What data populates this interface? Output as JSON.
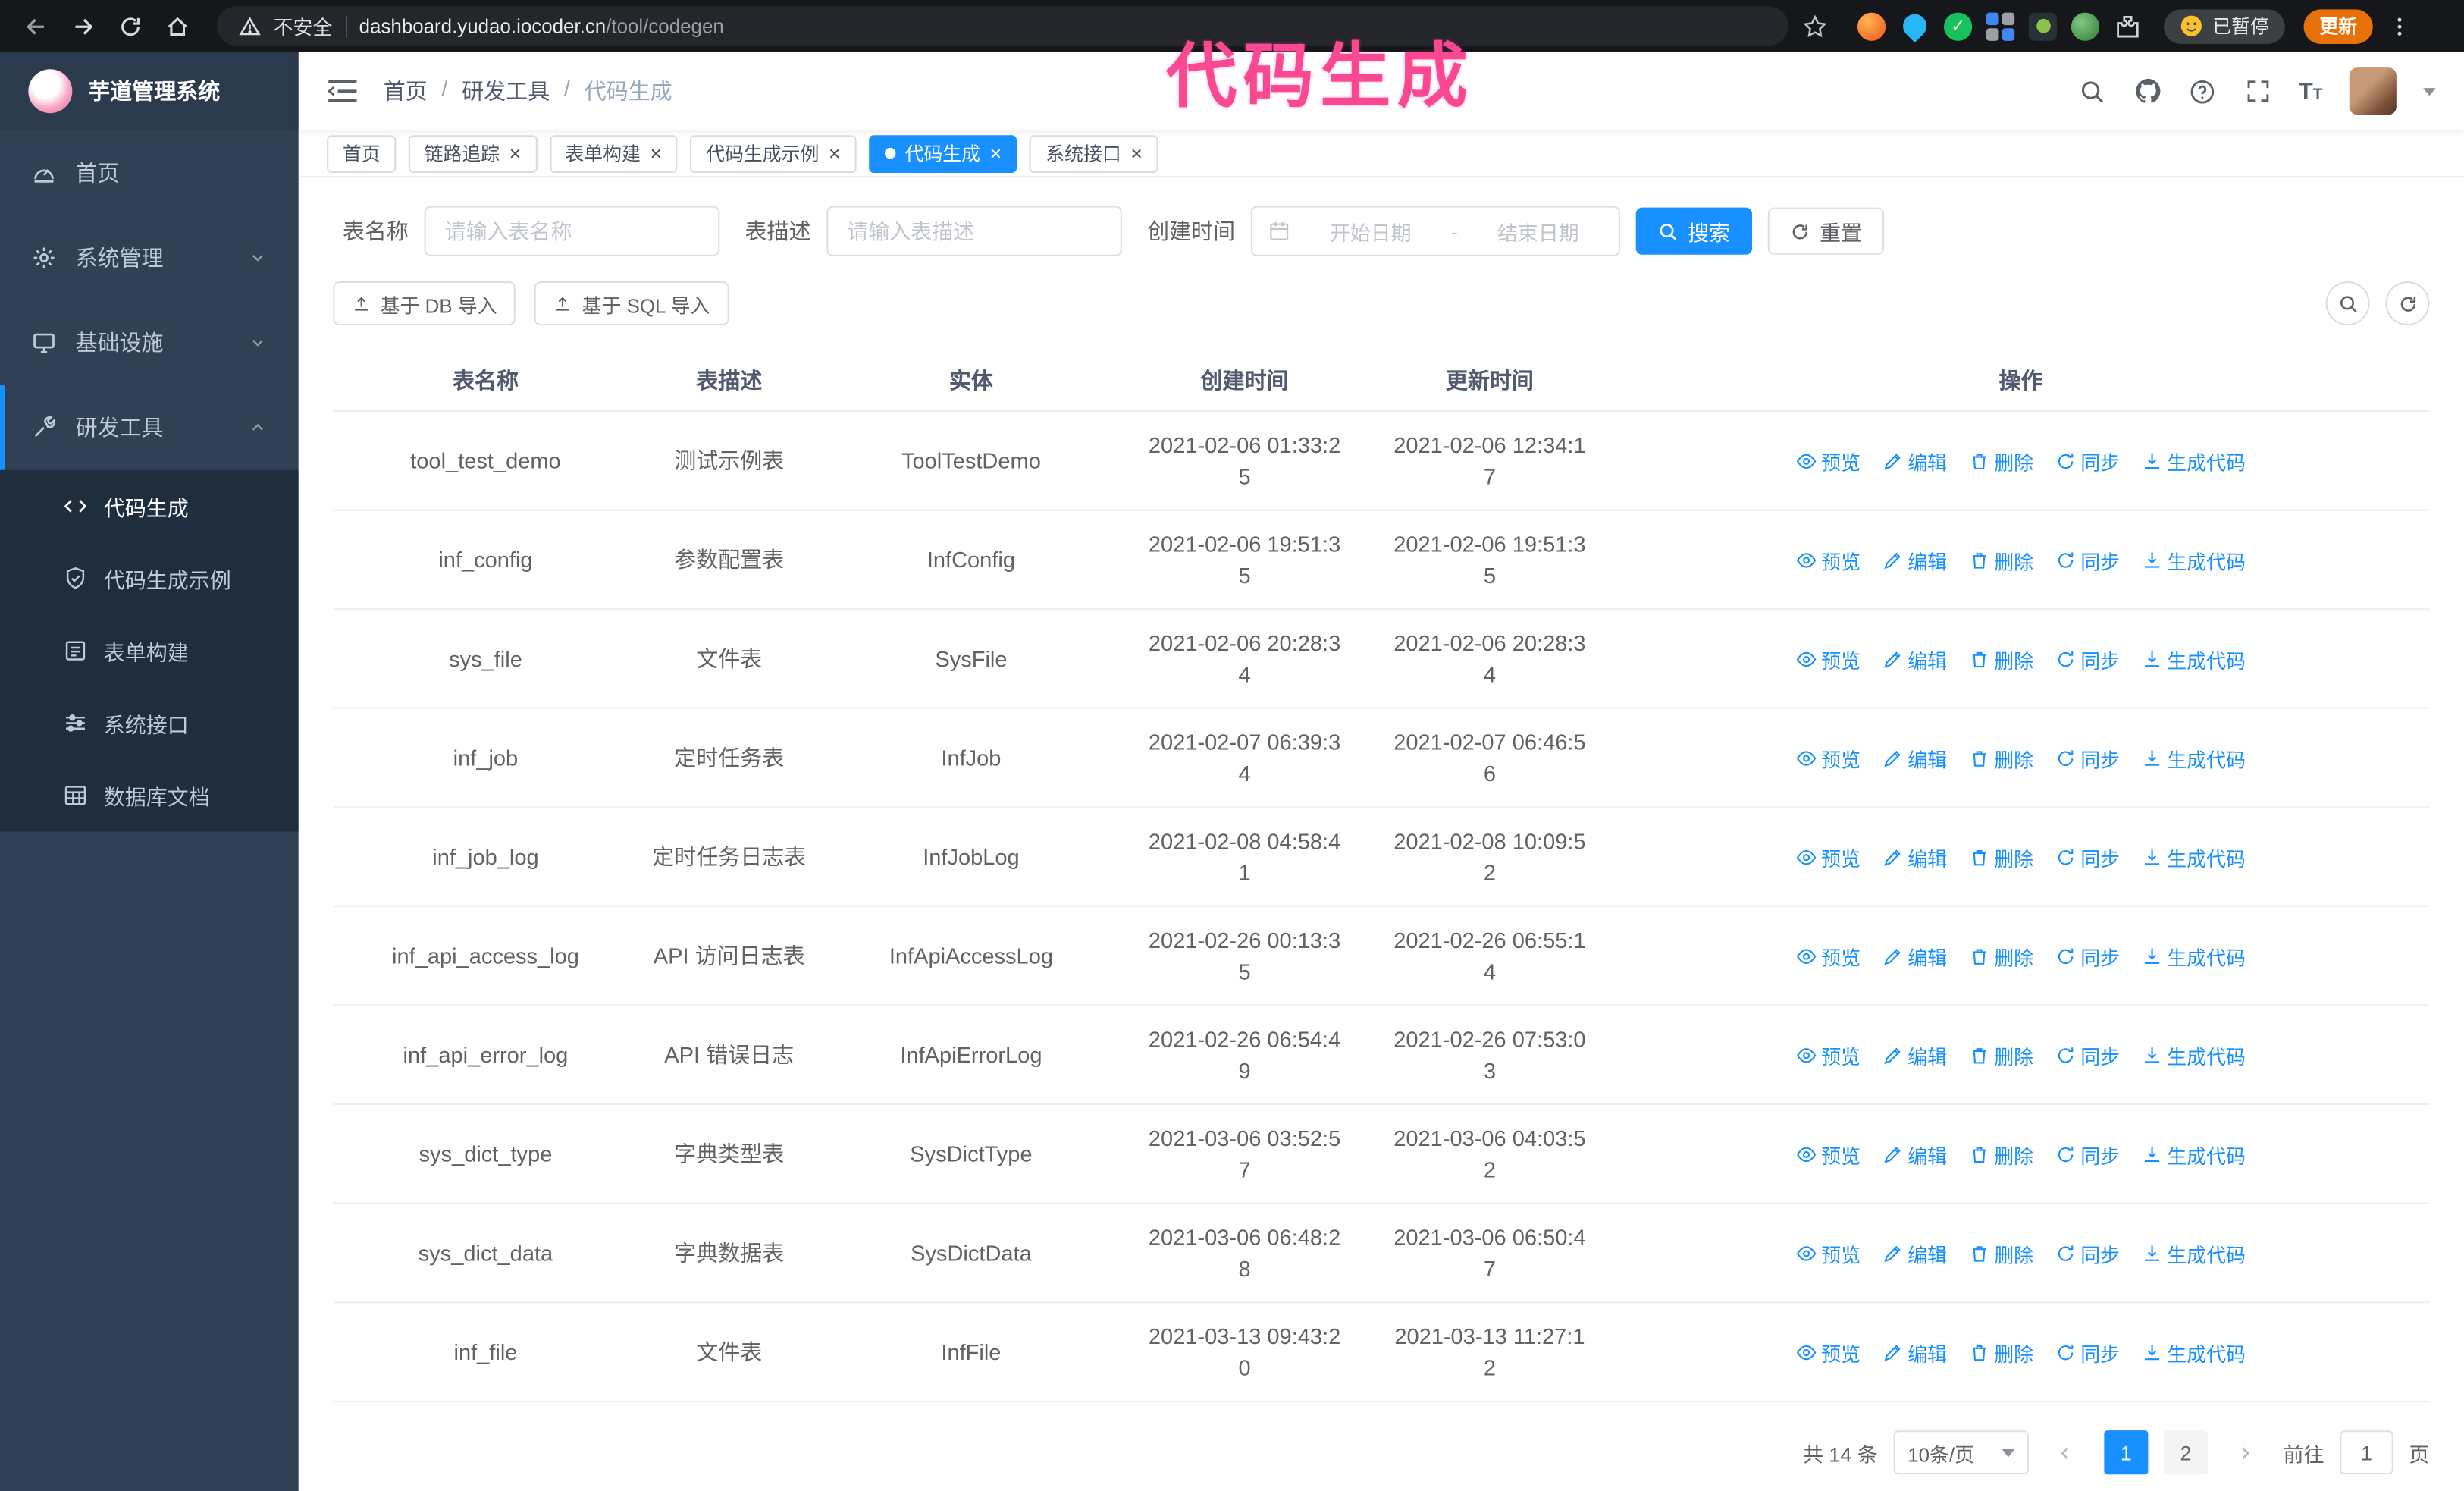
{
  "browser": {
    "security_label": "不安全",
    "url_host": "dashboard.yudao.iocoder.cn",
    "url_path": "/tool/codegen",
    "paused_badge": "已暂停",
    "update_button": "更新"
  },
  "overlay": {
    "title": "代码生成",
    "color": "#fb4893"
  },
  "sidebar": {
    "logo_title": "芋道管理系统",
    "items": [
      {
        "label": "首页"
      },
      {
        "label": "系统管理"
      },
      {
        "label": "基础设施"
      },
      {
        "label": "研发工具"
      }
    ],
    "sub_items": [
      {
        "label": "代码生成",
        "active": true
      },
      {
        "label": "代码生成示例"
      },
      {
        "label": "表单构建"
      },
      {
        "label": "系统接口"
      },
      {
        "label": "数据库文档"
      }
    ]
  },
  "header": {
    "breadcrumb": [
      "首页",
      "研发工具",
      "代码生成"
    ],
    "breadcrumb_separator": "/"
  },
  "tabs": {
    "items": [
      "首页",
      "链路追踪",
      "表单构建",
      "代码生成示例",
      "代码生成",
      "系统接口"
    ],
    "active_tab": "代码生成"
  },
  "filters": {
    "table_name_label": "表名称",
    "table_name_placeholder": "请输入表名称",
    "table_desc_label": "表描述",
    "table_desc_placeholder": "请输入表描述",
    "create_time_label": "创建时间",
    "date_start_placeholder": "开始日期",
    "date_separator": "-",
    "date_end_placeholder": "结束日期",
    "search_button": "搜索",
    "reset_button": "重置"
  },
  "toolbar": {
    "import_db_button": "基于 DB 导入",
    "import_sql_button": "基于 SQL 导入"
  },
  "table": {
    "columns": [
      "表名称",
      "表描述",
      "实体",
      "创建时间",
      "更新时间",
      "操作"
    ],
    "action_labels": [
      "预览",
      "编辑",
      "删除",
      "同步",
      "生成代码"
    ],
    "rows": [
      {
        "name": "tool_test_demo",
        "desc": "测试示例表",
        "entity": "ToolTestDemo",
        "created": "2021-02-06 01:33:25",
        "updated": "2021-02-06 12:34:17"
      },
      {
        "name": "inf_config",
        "desc": "参数配置表",
        "entity": "InfConfig",
        "created": "2021-02-06 19:51:35",
        "updated": "2021-02-06 19:51:35"
      },
      {
        "name": "sys_file",
        "desc": "文件表",
        "entity": "SysFile",
        "created": "2021-02-06 20:28:34",
        "updated": "2021-02-06 20:28:34"
      },
      {
        "name": "inf_job",
        "desc": "定时任务表",
        "entity": "InfJob",
        "created": "2021-02-07 06:39:34",
        "updated": "2021-02-07 06:46:56"
      },
      {
        "name": "inf_job_log",
        "desc": "定时任务日志表",
        "entity": "InfJobLog",
        "created": "2021-02-08 04:58:41",
        "updated": "2021-02-08 10:09:52"
      },
      {
        "name": "inf_api_access_log",
        "desc": "API 访问日志表",
        "entity": "InfApiAccessLog",
        "created": "2021-02-26 00:13:35",
        "updated": "2021-02-26 06:55:14"
      },
      {
        "name": "inf_api_error_log",
        "desc": "API 错误日志",
        "entity": "InfApiErrorLog",
        "created": "2021-02-26 06:54:49",
        "updated": "2021-02-26 07:53:03"
      },
      {
        "name": "sys_dict_type",
        "desc": "字典类型表",
        "entity": "SysDictType",
        "created": "2021-03-06 03:52:57",
        "updated": "2021-03-06 04:03:52"
      },
      {
        "name": "sys_dict_data",
        "desc": "字典数据表",
        "entity": "SysDictData",
        "created": "2021-03-06 06:48:28",
        "updated": "2021-03-06 06:50:47"
      },
      {
        "name": "inf_file",
        "desc": "文件表",
        "entity": "InfFile",
        "created": "2021-03-13 09:43:20",
        "updated": "2021-03-13 11:27:12"
      }
    ]
  },
  "pagination": {
    "total_label": "共 14 条",
    "page_size": "10条/页",
    "pages": [
      "1",
      "2"
    ],
    "active_page": "1",
    "goto_label": "前往",
    "goto_value": "1",
    "page_unit": "页"
  },
  "colors": {
    "accent": "#1890ff",
    "sidebar_bg": "#304156",
    "submenu_bg": "#1f2d3d",
    "overlay_pink": "#fb4893",
    "update_orange": "#e8710a"
  }
}
